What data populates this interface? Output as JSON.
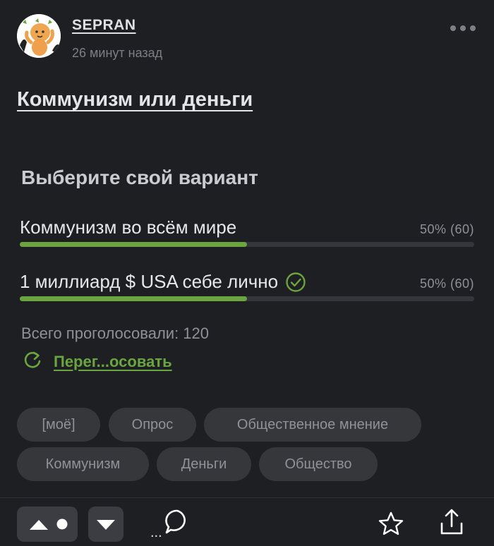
{
  "post": {
    "username": "SEPRAN",
    "time": "26 минут назад",
    "title": "Коммунизм или деньги"
  },
  "poll": {
    "question": "Выберите свой вариант",
    "options": [
      {
        "label": "Коммунизм во всём мире",
        "result": "50% (60)",
        "percent": 50,
        "selected": false
      },
      {
        "label": "1 миллиард $ USA себе лично",
        "result": "50% (60)",
        "percent": 50,
        "selected": true
      }
    ],
    "total": "Всего проголосовали: 120",
    "revote_label": "Перег...осовать"
  },
  "tags": [
    "[моё]",
    "Опрос",
    "Общественное мнение",
    "Коммунизм",
    "Деньги",
    "Общество"
  ],
  "footer": {
    "comments_prefix": "..."
  },
  "colors": {
    "background": "#1e1f22",
    "accent_green": "#6aa53f",
    "tag_bg": "#35373b",
    "button_bg": "#3b3d42"
  },
  "icons": {
    "more": "more-dots-icon",
    "selected": "check-circle-icon",
    "revote": "refresh-icon",
    "upvote": "triangle-up-icon",
    "downvote": "triangle-down-icon",
    "comments": "speech-bubble-icon",
    "save": "star-icon",
    "share": "share-icon"
  }
}
